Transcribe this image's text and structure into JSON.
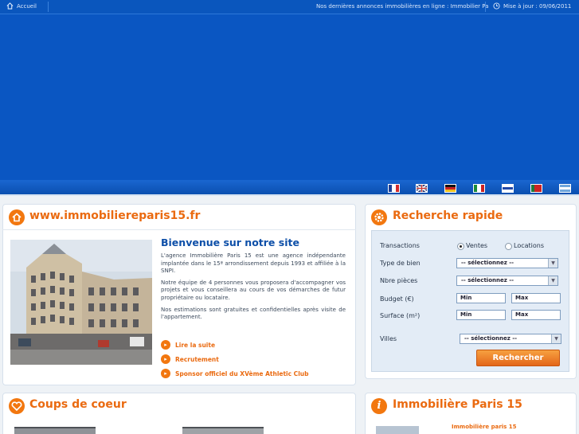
{
  "topbar": {
    "home_label": "Accueil",
    "ticker": "Nos dernières annonces immobilières en ligne : Immobilier Pa",
    "update": "Mise à jour : 09/06/2011"
  },
  "languages": [
    {
      "name": "fr-flag",
      "colors": [
        "#1c3f96",
        "#ffffff",
        "#d22b2b"
      ],
      "dir": "v"
    },
    {
      "name": "uk-flag",
      "colors": [
        "#22336e",
        "#c9302c",
        "#ffffff"
      ],
      "dir": "uk"
    },
    {
      "name": "de-flag",
      "colors": [
        "#111111",
        "#cc2222",
        "#f0c020"
      ],
      "dir": "h"
    },
    {
      "name": "it-flag",
      "colors": [
        "#1a8c3a",
        "#ffffff",
        "#cc2222"
      ],
      "dir": "v"
    },
    {
      "name": "il-flag",
      "colors": [
        "#ffffff",
        "#2148a8",
        "#ffffff"
      ],
      "dir": "h"
    },
    {
      "name": "pt-flag",
      "colors": [
        "#1a7a3a",
        "#cc2222",
        "#cc2222"
      ],
      "dir": "v"
    },
    {
      "name": "ar-flag",
      "colors": [
        "#6fa6dc",
        "#ffffff",
        "#6fa6dc"
      ],
      "dir": "h"
    }
  ],
  "main_panel": {
    "title": "www.immobiliereparis15.fr",
    "welcome_title": "Bienvenue sur notre site",
    "paragraphs": [
      "L'agence Immobilière Paris 15 est une agence indépendante implantée dans le 15ª arrondissement depuis 1993 et affiliée à la SNPI.",
      "Notre équipe de 4 personnes vous proposera d'accompagner vos projets et vous conseillera au cours de vos démarches de futur propriétaire ou locataire.",
      "Nos estimations sont gratuites et confidentielles après visite de l'appartement."
    ],
    "links": [
      "Lire la suite",
      "Recrutement",
      "Sponsor officiel du XVème Athletic Club"
    ]
  },
  "search": {
    "title": "Recherche rapide",
    "transactions_label": "Transactions",
    "radio_options": [
      "Ventes",
      "Locations"
    ],
    "type_label": "Type de bien",
    "pieces_label": "Nbre pièces",
    "budget_label": "Budget (€)",
    "surface_label": "Surface (m²)",
    "villes_label": "Villes",
    "select_value": "-- sélectionnez --",
    "min_label": "Min",
    "max_label": "Max",
    "button": "Rechercher"
  },
  "bottom": {
    "coups_title": "Coups de coeur",
    "agency_title": "Immobilière Paris 15",
    "agency_sub": "Immobilière paris 15"
  },
  "colors": {
    "brand_blue": "#0a56c2",
    "accent_orange": "#ea6a10"
  }
}
